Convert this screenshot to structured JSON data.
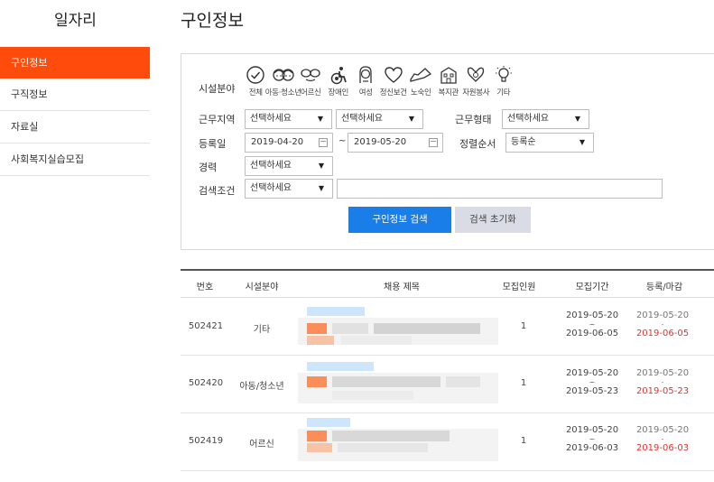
{
  "sidebar": {
    "title": "일자리",
    "items": [
      {
        "label": "구인정보",
        "active": true
      },
      {
        "label": "구직정보",
        "active": false
      },
      {
        "label": "자료실",
        "active": false
      },
      {
        "label": "사회복지실습모집",
        "active": false
      }
    ]
  },
  "page": {
    "title": "구인정보"
  },
  "search": {
    "category_label": "시설분야",
    "categories": [
      {
        "label": "전체",
        "icon": "check-circle-icon"
      },
      {
        "label": "아동·청소년",
        "icon": "children-icon"
      },
      {
        "label": "어르신",
        "icon": "glasses-icon"
      },
      {
        "label": "장애인",
        "icon": "wheelchair-icon"
      },
      {
        "label": "여성",
        "icon": "woman-icon"
      },
      {
        "label": "정신보건",
        "icon": "heart-icon"
      },
      {
        "label": "노숙인",
        "icon": "shoe-icon"
      },
      {
        "label": "복지관",
        "icon": "building-icon"
      },
      {
        "label": "자원봉사",
        "icon": "handshake-icon"
      },
      {
        "label": "기타",
        "icon": "lightbulb-icon"
      }
    ],
    "region_label": "근무지역",
    "region_select_1": "선택하세요",
    "region_select_2": "선택하세요",
    "worktype_label": "근무형태",
    "worktype_select": "선택하세요",
    "date_label": "등록일",
    "date_from": "2019-04-20",
    "date_to": "2019-05-20",
    "tilde": "~",
    "sort_label": "정렬순서",
    "sort_select": "등록순",
    "career_label": "경력",
    "career_select": "선택하세요",
    "cond_label": "검색조건",
    "cond_select": "선택하세요",
    "keyword": "",
    "search_button": "구인정보 검색",
    "reset_button": "검색 초기화"
  },
  "table": {
    "headers": [
      "번호",
      "시설분야",
      "채용 제목",
      "모집인원",
      "모집기간",
      "등록/마감"
    ],
    "rows": [
      {
        "no": "502421",
        "field": "기타",
        "count": "1",
        "period_from": "2019-05-20",
        "period_sep": "~",
        "period_to": "2019-06-05",
        "reg": "2019-05-20",
        "reg_sep": "-",
        "deadline": "2019-06-05"
      },
      {
        "no": "502420",
        "field": "아동/청소년",
        "count": "1",
        "period_from": "2019-05-20",
        "period_sep": "~",
        "period_to": "2019-05-23",
        "reg": "2019-05-20",
        "reg_sep": "-",
        "deadline": "2019-05-23"
      },
      {
        "no": "502419",
        "field": "어르신",
        "count": "1",
        "period_from": "2019-05-20",
        "period_sep": "~",
        "period_to": "2019-06-03",
        "reg": "2019-05-20",
        "reg_sep": "-",
        "deadline": "2019-06-03"
      }
    ]
  },
  "colors": {
    "accent": "#ff4c0c",
    "primary_button": "#1a7ee8",
    "deadline": "#e8312b"
  }
}
